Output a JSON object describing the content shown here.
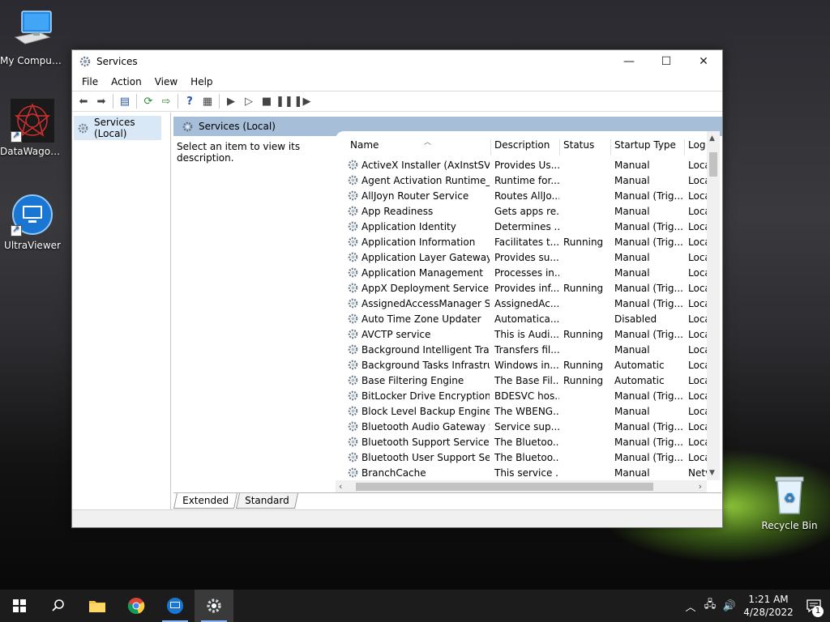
{
  "desktop": {
    "icons": [
      {
        "label": "My Computer"
      },
      {
        "label": "DataWagon..."
      },
      {
        "label": "UltraViewer"
      },
      {
        "label": "Recycle Bin"
      }
    ]
  },
  "window": {
    "title": "Services",
    "menu": [
      "File",
      "Action",
      "View",
      "Help"
    ],
    "tree": {
      "selected": "Services (Local)"
    },
    "pane_header": "Services (Local)",
    "description_prompt": "Select an item to view its description.",
    "columns": [
      "Name",
      "Description",
      "Status",
      "Startup Type",
      "Log"
    ],
    "rows": [
      {
        "name": "ActiveX Installer (AxInstSV)",
        "desc": "Provides Us...",
        "status": "",
        "startup": "Manual",
        "logon": "Loca"
      },
      {
        "name": "Agent Activation Runtime_...",
        "desc": "Runtime for...",
        "status": "",
        "startup": "Manual",
        "logon": "Loca"
      },
      {
        "name": "AllJoyn Router Service",
        "desc": "Routes AllJo...",
        "status": "",
        "startup": "Manual (Trig...",
        "logon": "Loca"
      },
      {
        "name": "App Readiness",
        "desc": "Gets apps re...",
        "status": "",
        "startup": "Manual",
        "logon": "Loca"
      },
      {
        "name": "Application Identity",
        "desc": "Determines ...",
        "status": "",
        "startup": "Manual (Trig...",
        "logon": "Loca"
      },
      {
        "name": "Application Information",
        "desc": "Facilitates t...",
        "status": "Running",
        "startup": "Manual (Trig...",
        "logon": "Loca"
      },
      {
        "name": "Application Layer Gateway ...",
        "desc": "Provides su...",
        "status": "",
        "startup": "Manual",
        "logon": "Loca"
      },
      {
        "name": "Application Management",
        "desc": "Processes in...",
        "status": "",
        "startup": "Manual",
        "logon": "Loca"
      },
      {
        "name": "AppX Deployment Service (...",
        "desc": "Provides inf...",
        "status": "Running",
        "startup": "Manual (Trig...",
        "logon": "Loca"
      },
      {
        "name": "AssignedAccessManager Se...",
        "desc": "AssignedAc...",
        "status": "",
        "startup": "Manual (Trig...",
        "logon": "Loca"
      },
      {
        "name": "Auto Time Zone Updater",
        "desc": "Automatica...",
        "status": "",
        "startup": "Disabled",
        "logon": "Loca"
      },
      {
        "name": "AVCTP service",
        "desc": "This is Audi...",
        "status": "Running",
        "startup": "Manual (Trig...",
        "logon": "Loca"
      },
      {
        "name": "Background Intelligent Tran...",
        "desc": "Transfers fil...",
        "status": "",
        "startup": "Manual",
        "logon": "Loca"
      },
      {
        "name": "Background Tasks Infrastruc...",
        "desc": "Windows in...",
        "status": "Running",
        "startup": "Automatic",
        "logon": "Loca"
      },
      {
        "name": "Base Filtering Engine",
        "desc": "The Base Fil...",
        "status": "Running",
        "startup": "Automatic",
        "logon": "Loca"
      },
      {
        "name": "BitLocker Drive Encryption ...",
        "desc": "BDESVC hos...",
        "status": "",
        "startup": "Manual (Trig...",
        "logon": "Loca"
      },
      {
        "name": "Block Level Backup Engine ...",
        "desc": "The WBENG...",
        "status": "",
        "startup": "Manual",
        "logon": "Loca"
      },
      {
        "name": "Bluetooth Audio Gateway S...",
        "desc": "Service sup...",
        "status": "",
        "startup": "Manual (Trig...",
        "logon": "Loca"
      },
      {
        "name": "Bluetooth Support Service",
        "desc": "The Bluetoo...",
        "status": "",
        "startup": "Manual (Trig...",
        "logon": "Loca"
      },
      {
        "name": "Bluetooth User Support Ser...",
        "desc": "The Bluetoo...",
        "status": "",
        "startup": "Manual (Trig...",
        "logon": "Loca"
      },
      {
        "name": "BranchCache",
        "desc": "This service ...",
        "status": "",
        "startup": "Manual",
        "logon": "Netv"
      }
    ],
    "tabs": [
      "Extended",
      "Standard"
    ],
    "active_tab": "Extended"
  },
  "taskbar": {
    "clock_time": "1:21 AM",
    "clock_date": "4/28/2022",
    "notification_count": "1"
  },
  "colors": {
    "pane_header": "#a6bed8",
    "tree_selection": "#d9e8f6",
    "taskbar": "#1c1c1c"
  }
}
